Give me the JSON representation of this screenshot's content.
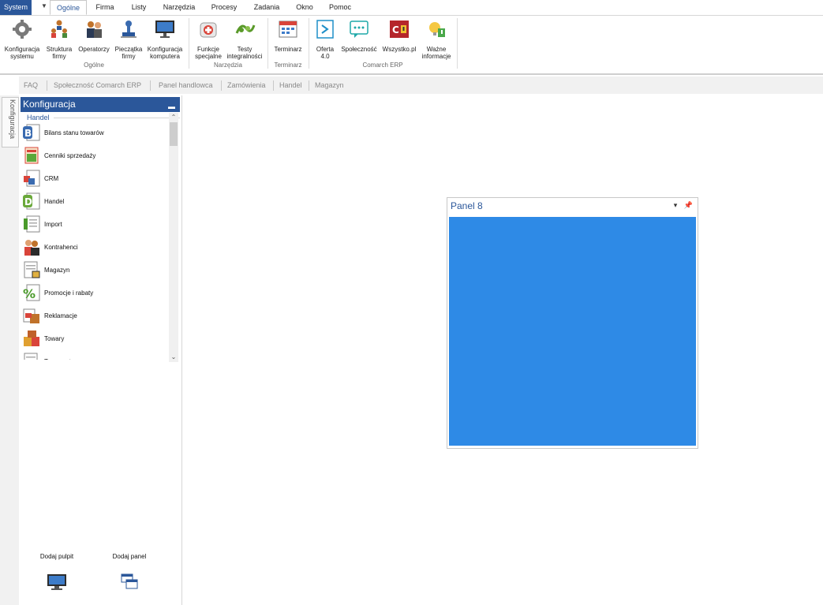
{
  "menu": {
    "system": "System",
    "tabs": [
      "Ogólne",
      "Firma",
      "Listy",
      "Narzędzia",
      "Procesy",
      "Zadania",
      "Okno",
      "Pomoc"
    ],
    "active_tab": "Ogólne"
  },
  "ribbon": {
    "buttons": {
      "konfiguracja_systemu": "Konfiguracja systemu",
      "struktura_firmy": "Struktura firmy",
      "operatorzy": "Operatorzy",
      "pieczatka_firmy": "Pieczątka firmy",
      "konfiguracja_komputera": "Konfiguracja komputera",
      "funkcje_specjalne": "Funkcje specjalne",
      "testy_integralnosci": "Testy integralności",
      "terminarz": "Terminarz",
      "oferta": "Oferta 4.0",
      "spolecznosc": "Społeczność",
      "wszystko": "Wszystko.pl",
      "wazne_informacje": "Ważne informacje"
    },
    "groups": {
      "ogolne": "Ogólne",
      "narzedzia": "Narzędzia",
      "terminarz": "Terminarz",
      "comarch": "Comarch ERP"
    }
  },
  "quick_links": [
    "FAQ",
    "Społeczność Comarch ERP",
    "Panel handlowca",
    "Zamówienia",
    "Handel",
    "Magazyn"
  ],
  "side_tab": "Konfiguracja",
  "config_panel": {
    "title": "Konfiguracja",
    "section": "Handel",
    "items": [
      {
        "label": "Bilans stanu towarów",
        "icon": "document-b-icon"
      },
      {
        "label": "Cenniki sprzedaży",
        "icon": "price-list-icon"
      },
      {
        "label": "CRM",
        "icon": "crm-icon"
      },
      {
        "label": "Handel",
        "icon": "document-d-icon"
      },
      {
        "label": "Import",
        "icon": "import-icon"
      },
      {
        "label": "Kontrahenci",
        "icon": "contractors-icon"
      },
      {
        "label": "Magazyn",
        "icon": "warehouse-icon"
      },
      {
        "label": "Promocje i rabaty",
        "icon": "percent-icon"
      },
      {
        "label": "Reklamacje",
        "icon": "complaints-icon"
      },
      {
        "label": "Towary",
        "icon": "goods-icon"
      },
      {
        "label": "Transport",
        "icon": "document-icon"
      }
    ],
    "add_desktop": "Dodaj pulpit",
    "add_panel": "Dodaj panel"
  },
  "desktop": {
    "panel_title": "Panel 8",
    "panel_color": "#2e8ae6"
  },
  "colors": {
    "accent": "#2b579a"
  }
}
